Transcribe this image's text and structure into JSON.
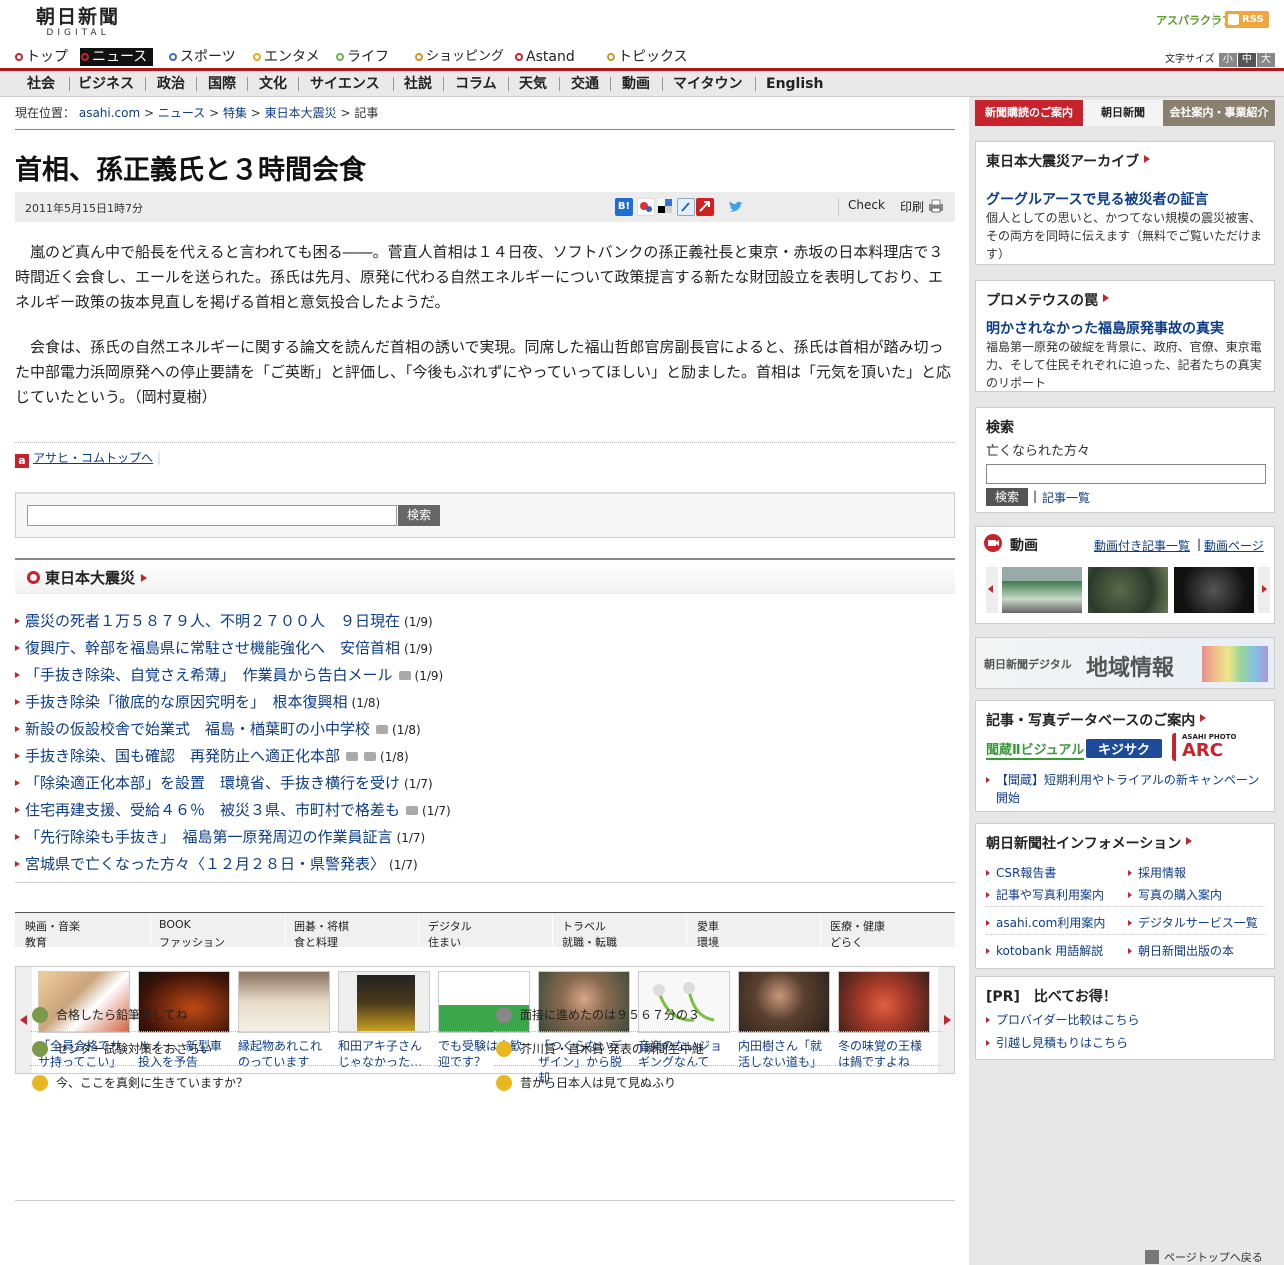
{
  "header": {
    "logo_top": "朝日新聞",
    "logo_bottom": "DIGITAL",
    "aspara": "アスパラクラブ",
    "rss": "RSS"
  },
  "global_nav": [
    {
      "label": "トップ",
      "color": "#c8232c"
    },
    {
      "label": "ニュース",
      "color": "#c8232c",
      "active": true
    },
    {
      "label": "スポーツ",
      "color": "#3a6fc0"
    },
    {
      "label": "エンタメ",
      "color": "#e6a81e"
    },
    {
      "label": "ライフ",
      "color": "#6ab04c"
    },
    {
      "label": "ショッピング",
      "color": "#e09020"
    },
    {
      "label": "Astand",
      "color": "#c8232c"
    },
    {
      "label": "トピックス",
      "color": "#c89a2c"
    }
  ],
  "font_size": {
    "label": "文字サイズ",
    "small": "小",
    "medium": "中",
    "large": "大"
  },
  "sub_nav": [
    "社会",
    "ビジネス",
    "政治",
    "国際",
    "文化",
    "サイエンス",
    "社説",
    "コラム",
    "天気",
    "交通",
    "動画",
    "マイタウン",
    "English"
  ],
  "breadcrumb": {
    "label": "現在位置：",
    "items": [
      "asahi.com",
      "ニュース",
      "特集",
      "東日本大震災"
    ],
    "current": "記事"
  },
  "article": {
    "title": "首相、孫正義氏と３時間会食",
    "date": "2011年5月15日1時7分",
    "check": "Check",
    "print": "印刷",
    "paragraphs": [
      "嵐のど真ん中で船長を代えると言われても困る――。菅直人首相は１４日夜、ソフトバンクの孫正義社長と東京・赤坂の日本料理店で３時間近く会食し、エールを送られた。孫氏は先月、原発に代わる自然エネルギーについて政策提言する新たな財団設立を表明しており、エネルギー政策の抜本見直しを掲げる首相と意気投合したようだ。",
      "会食は、孫氏の自然エネルギーに関する論文を読んだ首相の誘いで実現。同席した福山哲郎官房副長官によると、孫氏は首相が踏み切った中部電力浜岡原発への停止要請を「ご英断」と評価し、「今後もぶれずにやっていってほしい」と励ました。首相は「元気を頂いた」と応じていたという。（岡村夏樹）"
    ],
    "home_link": "アサヒ・コムトップへ",
    "home_icon": "a"
  },
  "search": {
    "button": "検索"
  },
  "quake": {
    "title": "東日本大震災",
    "items": [
      {
        "text": "震災の死者１万５８７９人、不明２７００人　９日現在",
        "date": "(1/9)",
        "photos": 0
      },
      {
        "text": "復興庁、幹部を福島県に常駐させ機能強化へ　安倍首相",
        "date": "(1/9)",
        "photos": 0
      },
      {
        "text": "「手抜き除染、自覚さえ希薄」　作業員から告白メール",
        "date": "(1/9)",
        "photos": 1
      },
      {
        "text": "手抜き除染「徹底的な原因究明を」　根本復興相",
        "date": "(1/8)",
        "photos": 0
      },
      {
        "text": "新設の仮設校舎で始業式　福島・楢葉町の小中学校",
        "date": "(1/8)",
        "photos": 1
      },
      {
        "text": "手抜き除染、国も確認　再発防止へ適正化本部",
        "date": "(1/8)",
        "photos": 2
      },
      {
        "text": "「除染適正化本部」を設置　環境省、手抜き横行を受け",
        "date": "(1/7)",
        "photos": 0
      },
      {
        "text": "住宅再建支援、受給４６％　被災３県、市町村で格差も",
        "date": "(1/7)",
        "photos": 1
      },
      {
        "text": "「先行除染も手抜き」　福島第一原発周辺の作業員証言",
        "date": "(1/7)",
        "photos": 0
      },
      {
        "text": "宮城県で亡くなった方々〈１２月２８日・県警発表〉",
        "date": "(1/7)",
        "photos": 0
      }
    ]
  },
  "categories": {
    "top": [
      "映画・音楽",
      "BOOK",
      "囲碁・将棋",
      "デジタル",
      "トラベル",
      "愛車",
      "医療・健康"
    ],
    "bottom": [
      "教育",
      "ファッション",
      "食と料理",
      "住まい",
      "就職・転職",
      "環境",
      "どらく"
    ]
  },
  "thumbs": [
    {
      "caption": "「全員合格でササ持ってこい」",
      "color": "#c9a37a"
    },
    {
      "caption": "ルノー、新型車投入を予告",
      "color": "#6a2a14"
    },
    {
      "caption": "縁起物あれこれのっています",
      "color": "#d8c8b8"
    },
    {
      "caption": "和田アキ子さんじゃなかった…",
      "color": "#3a3020"
    },
    {
      "caption": "でも受験は大歓迎です？",
      "color": "#3aa84a"
    },
    {
      "caption": "「つくらないデザイン」から脱却",
      "color": "#8a7a6a"
    },
    {
      "caption": "音楽のないジョギングなんて",
      "color": "#e8e8e8"
    },
    {
      "caption": "内田樹さん「就活しない道も」",
      "color": "#5a4a3a"
    },
    {
      "caption": "冬の味覚の王様は鍋ですよね",
      "color": "#a83a2a"
    }
  ],
  "bottom_links": [
    {
      "text": "合格したら鉛筆返してね",
      "icon": "pencil-icon",
      "color": "#7a9a4a"
    },
    {
      "text": "面接に進めたのは９５６７分の３",
      "icon": "speaker-icon",
      "color": "#888888"
    },
    {
      "text": "センター試験対策をおさらい",
      "icon": "pencil-icon",
      "color": "#7a9a4a"
    },
    {
      "text": "芥川賞・直木賞 発表の瞬間生中継",
      "icon": "chat-icon",
      "color": "#e8b820"
    },
    {
      "text": "今、ここを真剣に生きていますか？",
      "icon": "chat-icon",
      "color": "#e8b820"
    },
    {
      "text": "昔から日本人は見て見ぬふり",
      "icon": "chat-icon",
      "color": "#e8b820"
    }
  ],
  "sidebar": {
    "banner": {
      "subscribe": "新聞購読のご案内",
      "brand": "朝日新聞",
      "company": "会社案内・事業紹介"
    },
    "archive": {
      "title": "東日本大震災アーカイブ",
      "headline": "グーグルアースで見る被災者の証言",
      "text": "個人としての思いと、かつてない規模の震災被害、その両方を同時に伝えます（無料でご覧いただけます）"
    },
    "prometheus": {
      "title": "プロメテウスの罠",
      "headline": "明かされなかった福島原発事故の真実",
      "text": "福島第一原発の破綻を背景に、政府、官僚、東京電力、そして住民それぞれに迫った、記者たちの真実のリポート"
    },
    "search": {
      "title": "検索",
      "label": "亡くなられた方々",
      "button": "検索",
      "list_link": "記事一覧"
    },
    "video": {
      "title": "動画",
      "link1": "動画付き記事一覧",
      "link2": "動画ページ"
    },
    "region": {
      "prefix": "朝日新聞デジタル",
      "main": "地域情報"
    },
    "database": {
      "title": "記事・写真データベースのご案内",
      "logos": [
        "聞蔵Ⅱビジュアル",
        "キジサク",
        "ARC"
      ],
      "arc_small": "ASAHI PHOTO",
      "link": "【聞蔵】短期利用やトライアルの新キャンペーン開始"
    },
    "info": {
      "title": "朝日新聞社インフォメーション",
      "links": [
        "CSR報告書",
        "採用情報",
        "記事や写真利用案内",
        "写真の購入案内",
        "asahi.com利用案内",
        "デジタルサービス一覧",
        "kotobank 用語解説",
        "朝日新聞出版の本"
      ]
    },
    "pr": {
      "title": "[PR]　比べてお得！",
      "links": [
        "プロバイダー比較はこちら",
        "引越し見積もりはこちら"
      ]
    },
    "page_top": "ページトップへ戻る"
  }
}
